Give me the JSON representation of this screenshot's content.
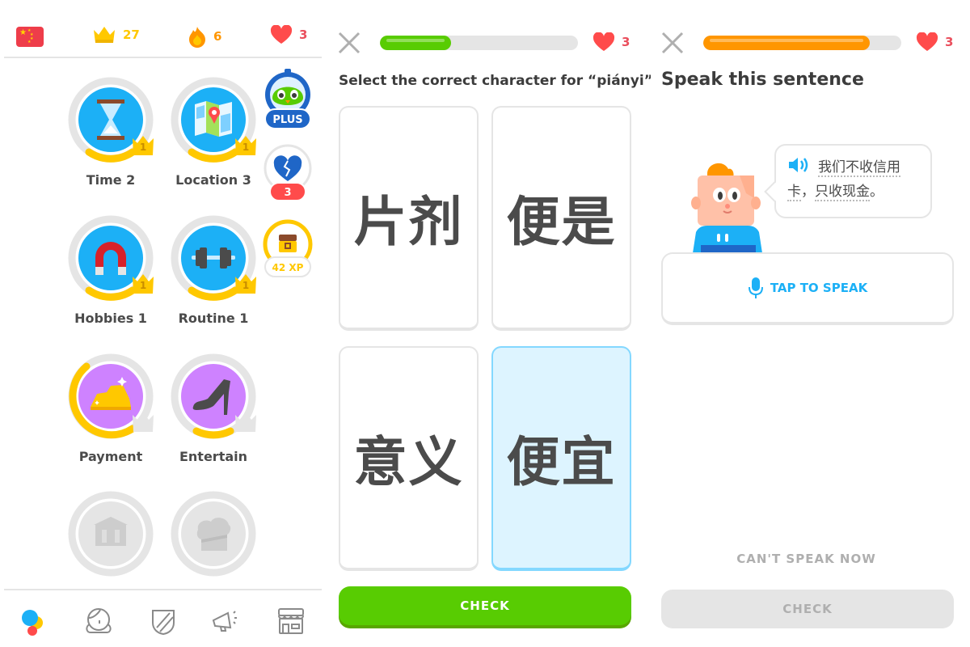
{
  "colors": {
    "green": "#58cc02",
    "orange": "#ff9600",
    "blue": "#1cb0f6",
    "gold": "#ffc800",
    "red": "#ff4b4b",
    "purple": "#ce82ff",
    "locked": "#e5e5e5"
  },
  "home": {
    "flag_icon": "china-flag-icon",
    "stats": {
      "crowns": "27",
      "streak": "6",
      "hearts": "3"
    },
    "skills": [
      {
        "label": "Time 2",
        "icon": "hourglass-icon",
        "crown_level": "1",
        "state": "learned"
      },
      {
        "label": "Location 3",
        "icon": "map-icon",
        "crown_level": "1",
        "state": "learned"
      },
      {
        "label": "Hobbies 1",
        "icon": "magnet-icon",
        "crown_level": "1",
        "state": "learned"
      },
      {
        "label": "Routine 1",
        "icon": "dumbbell-icon",
        "crown_level": "1",
        "state": "learned"
      },
      {
        "label": "Payment",
        "icon": "gold-bar-icon",
        "crown_level": "",
        "state": "in-progress"
      },
      {
        "label": "Entertain",
        "icon": "high-heel-icon",
        "crown_level": "",
        "state": "in-progress"
      },
      {
        "label": "",
        "icon": "bank-icon",
        "crown_level": "",
        "state": "locked"
      },
      {
        "label": "",
        "icon": "chef-hat-icon",
        "crown_level": "",
        "state": "locked"
      }
    ],
    "side": {
      "plus_label": "PLUS",
      "broken_hearts": "3",
      "xp_label": "42 XP"
    },
    "nav": [
      {
        "name": "learn",
        "icon": "learn-dots-icon",
        "active": true
      },
      {
        "name": "profile",
        "icon": "profile-icon",
        "active": false
      },
      {
        "name": "leagues",
        "icon": "shield-icon",
        "active": false
      },
      {
        "name": "news",
        "icon": "megaphone-icon",
        "active": false
      },
      {
        "name": "shop",
        "icon": "shop-icon",
        "active": false
      }
    ]
  },
  "select_lesson": {
    "progress_percent": 36,
    "hearts": "3",
    "prompt": "Select the correct character for “piányi”",
    "choices": [
      {
        "text": "片剂",
        "selected": false
      },
      {
        "text": "便是",
        "selected": false
      },
      {
        "text": "意义",
        "selected": false
      },
      {
        "text": "便宜",
        "selected": true
      }
    ],
    "check_label": "CHECK"
  },
  "speak_lesson": {
    "progress_percent": 84,
    "hearts": "3",
    "title": "Speak this sentence",
    "sentence_line1": "我们不收信用",
    "sentence_line2a": "卡",
    "sentence_line2b": "，",
    "sentence_line2c": "只收现金",
    "sentence_line2d": "。",
    "tap_to_speak_label": "TAP TO SPEAK",
    "cant_speak_label": "CAN'T SPEAK NOW",
    "check_label": "CHECK"
  }
}
